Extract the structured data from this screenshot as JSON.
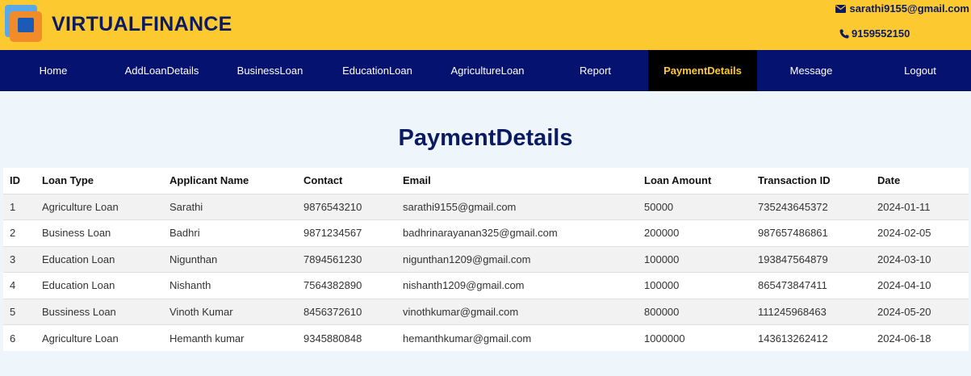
{
  "header": {
    "brand": "VIRTUALFINANCE",
    "email": "sarathi9155@gmail.com",
    "phone": "9159552150",
    "icons": {
      "email": "envelope-icon",
      "phone": "phone-icon"
    }
  },
  "nav": {
    "items": [
      {
        "label": "Home"
      },
      {
        "label": "AddLoanDetails"
      },
      {
        "label": "BusinessLoan"
      },
      {
        "label": "EducationLoan"
      },
      {
        "label": "AgricultureLoan"
      },
      {
        "label": "Report"
      },
      {
        "label": "PaymentDetails"
      },
      {
        "label": "Message"
      },
      {
        "label": "Logout"
      }
    ],
    "active": "PaymentDetails"
  },
  "main": {
    "title": "PaymentDetails",
    "table": {
      "columns": [
        "ID",
        "Loan Type",
        "Applicant Name",
        "Contact",
        "Email",
        "Loan Amount",
        "Transaction ID",
        "Date"
      ],
      "rows": [
        [
          "1",
          "Agriculture Loan",
          "Sarathi",
          "9876543210",
          "sarathi9155@gmail.com",
          "50000",
          "735243645372",
          "2024-01-11"
        ],
        [
          "2",
          "Business Loan",
          "Badhri",
          "9871234567",
          "badhrinarayanan325@gmail.com",
          "200000",
          "987657486861",
          "2024-02-05"
        ],
        [
          "3",
          "Education Loan",
          "Nigunthan",
          "7894561230",
          "nigunthan1209@gmail.com",
          "100000",
          "193847564879",
          "2024-03-10"
        ],
        [
          "4",
          "Education Loan",
          "Nishanth",
          "7564382890",
          "nishanth1209@gmail.com",
          "100000",
          "865473847411",
          "2024-04-10"
        ],
        [
          "5",
          "Bussiness Loan",
          "Vinoth Kumar",
          "8456372610",
          "vinothkumar@gmail.com",
          "800000",
          "111245968463",
          "2024-05-20"
        ],
        [
          "6",
          "Agriculture Loan",
          "Hemanth kumar",
          "9345880848",
          "hemanthkumar@gmail.com",
          "1000000",
          "143613262412",
          "2024-06-18"
        ]
      ]
    }
  },
  "colors": {
    "header_bg": "#fdc930",
    "nav_bg": "#061270",
    "active_bg": "#000000",
    "active_text": "#fdc930",
    "title": "#0a1a63"
  }
}
